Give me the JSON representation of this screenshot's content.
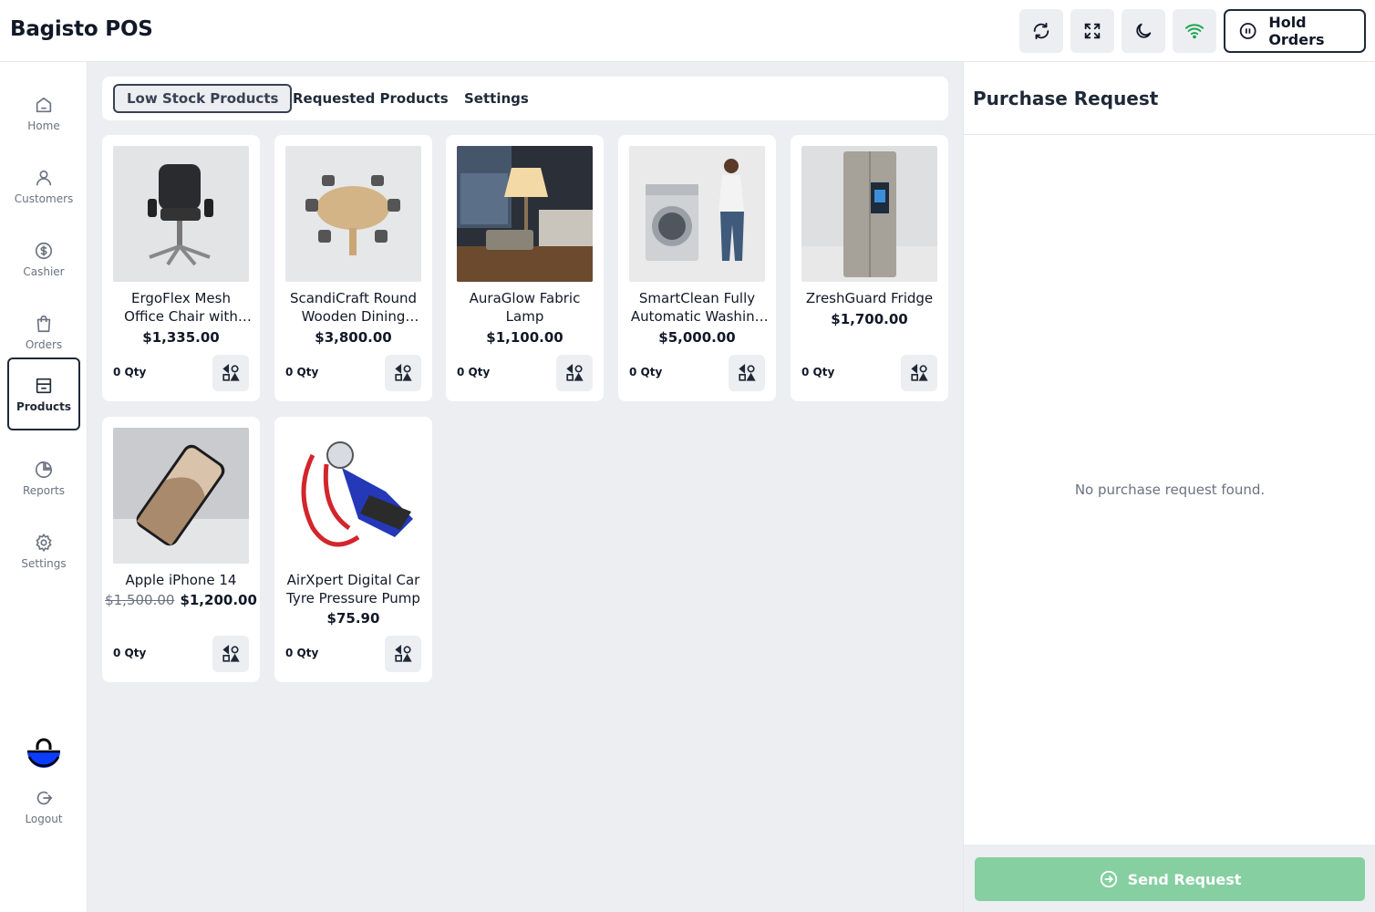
{
  "app": {
    "title": "Bagisto POS"
  },
  "header": {
    "buttons": [
      {
        "name": "refresh",
        "icon": "refresh-icon"
      },
      {
        "name": "fullscreen",
        "icon": "expand-icon"
      },
      {
        "name": "dark-mode",
        "icon": "moon-icon"
      },
      {
        "name": "online-status",
        "icon": "wifi-icon",
        "color": "#16a34a"
      }
    ],
    "hold_orders_label": "Hold Orders"
  },
  "sidebar": {
    "items": [
      {
        "label": "Home",
        "icon": "home-icon"
      },
      {
        "label": "Customers",
        "icon": "user-icon"
      },
      {
        "label": "Cashier",
        "icon": "dollar-circle-icon"
      },
      {
        "label": "Orders",
        "icon": "shopping-bag-icon"
      },
      {
        "label": "Products",
        "icon": "product-box-icon",
        "active": true
      },
      {
        "label": "Reports",
        "icon": "pie-chart-icon"
      },
      {
        "label": "Settings",
        "icon": "gear-icon"
      }
    ],
    "logout_label": "Logout"
  },
  "tabs": [
    {
      "label": "Low Stock Products",
      "active": true
    },
    {
      "label": "Requested Products"
    },
    {
      "label": "Settings"
    }
  ],
  "products": [
    {
      "name": "ErgoFlex Mesh Office Chair with Adjustable Lumbar Support",
      "price": "$1,335.00",
      "qty": "0 Qty",
      "image": "office-chair"
    },
    {
      "name": "ScandiCraft Round Wooden Dining Table Set",
      "price": "$3,800.00",
      "qty": "0 Qty",
      "image": "dining-table"
    },
    {
      "name": "AuraGlow Fabric Lamp",
      "price": "$1,100.00",
      "qty": "0 Qty",
      "image": "lamp"
    },
    {
      "name": "SmartClean Fully Automatic Washing Machine",
      "price": "$5,000.00",
      "qty": "0 Qty",
      "image": "washing-machine"
    },
    {
      "name": "ZreshGuard Fridge",
      "price": "$1,700.00",
      "qty": "0 Qty",
      "image": "fridge"
    },
    {
      "name": "Apple iPhone 14",
      "original_price": "$1,500.00",
      "price": "$1,200.00",
      "qty": "0 Qty",
      "image": "iphone"
    },
    {
      "name": "AirXpert Digital Car Tyre Pressure Pump",
      "price": "$75.90",
      "qty": "0 Qty",
      "image": "air-pump"
    }
  ],
  "purchase_request": {
    "title": "Purchase Request",
    "empty_text": "No purchase request found.",
    "send_label": "Send Request",
    "send_color": "#86cfa0"
  }
}
